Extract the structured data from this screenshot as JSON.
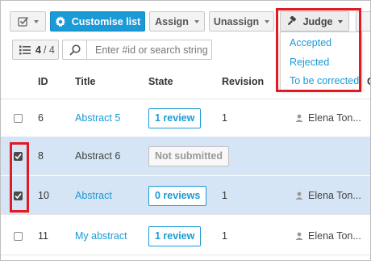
{
  "toolbar": {
    "customise_label": "Customise list",
    "assign_label": "Assign",
    "unassign_label": "Unassign",
    "judge_label": "Judge"
  },
  "judge_menu": {
    "items": [
      "Accepted",
      "Rejected",
      "To be corrected"
    ]
  },
  "list_controls": {
    "selected_count": "4",
    "total_count": "/ 4",
    "search_placeholder": "Enter #id or search string"
  },
  "table": {
    "headers": {
      "id": "ID",
      "title": "Title",
      "state": "State",
      "revision": "Revision",
      "next": "C"
    },
    "rows": [
      {
        "checked": false,
        "id": "6",
        "title": "Abstract 5",
        "title_is_link": true,
        "state": "1 review",
        "state_style": "button",
        "revision": "1",
        "person": "Elena Ton..."
      },
      {
        "checked": true,
        "id": "8",
        "title": "Abstract 6",
        "title_is_link": false,
        "state": "Not submitted",
        "state_style": "muted",
        "revision": "",
        "person": ""
      },
      {
        "checked": true,
        "id": "10",
        "title": "Abstract",
        "title_is_link": true,
        "state": "0 reviews",
        "state_style": "button",
        "revision": "1",
        "person": "Elena Ton..."
      },
      {
        "checked": false,
        "id": "11",
        "title": "My abstract",
        "title_is_link": true,
        "state": "1 review",
        "state_style": "button",
        "revision": "1",
        "person": "Elena Ton..."
      }
    ]
  },
  "colors": {
    "accent": "#1a9ad6",
    "selected_row": "#d5e5f5",
    "highlight": "#e01b24"
  },
  "icons": {
    "select": "checkbox-select-icon",
    "customise": "gear-icon",
    "judge": "gavel-icon",
    "count": "list-icon",
    "search": "search-icon",
    "person": "user-icon"
  }
}
